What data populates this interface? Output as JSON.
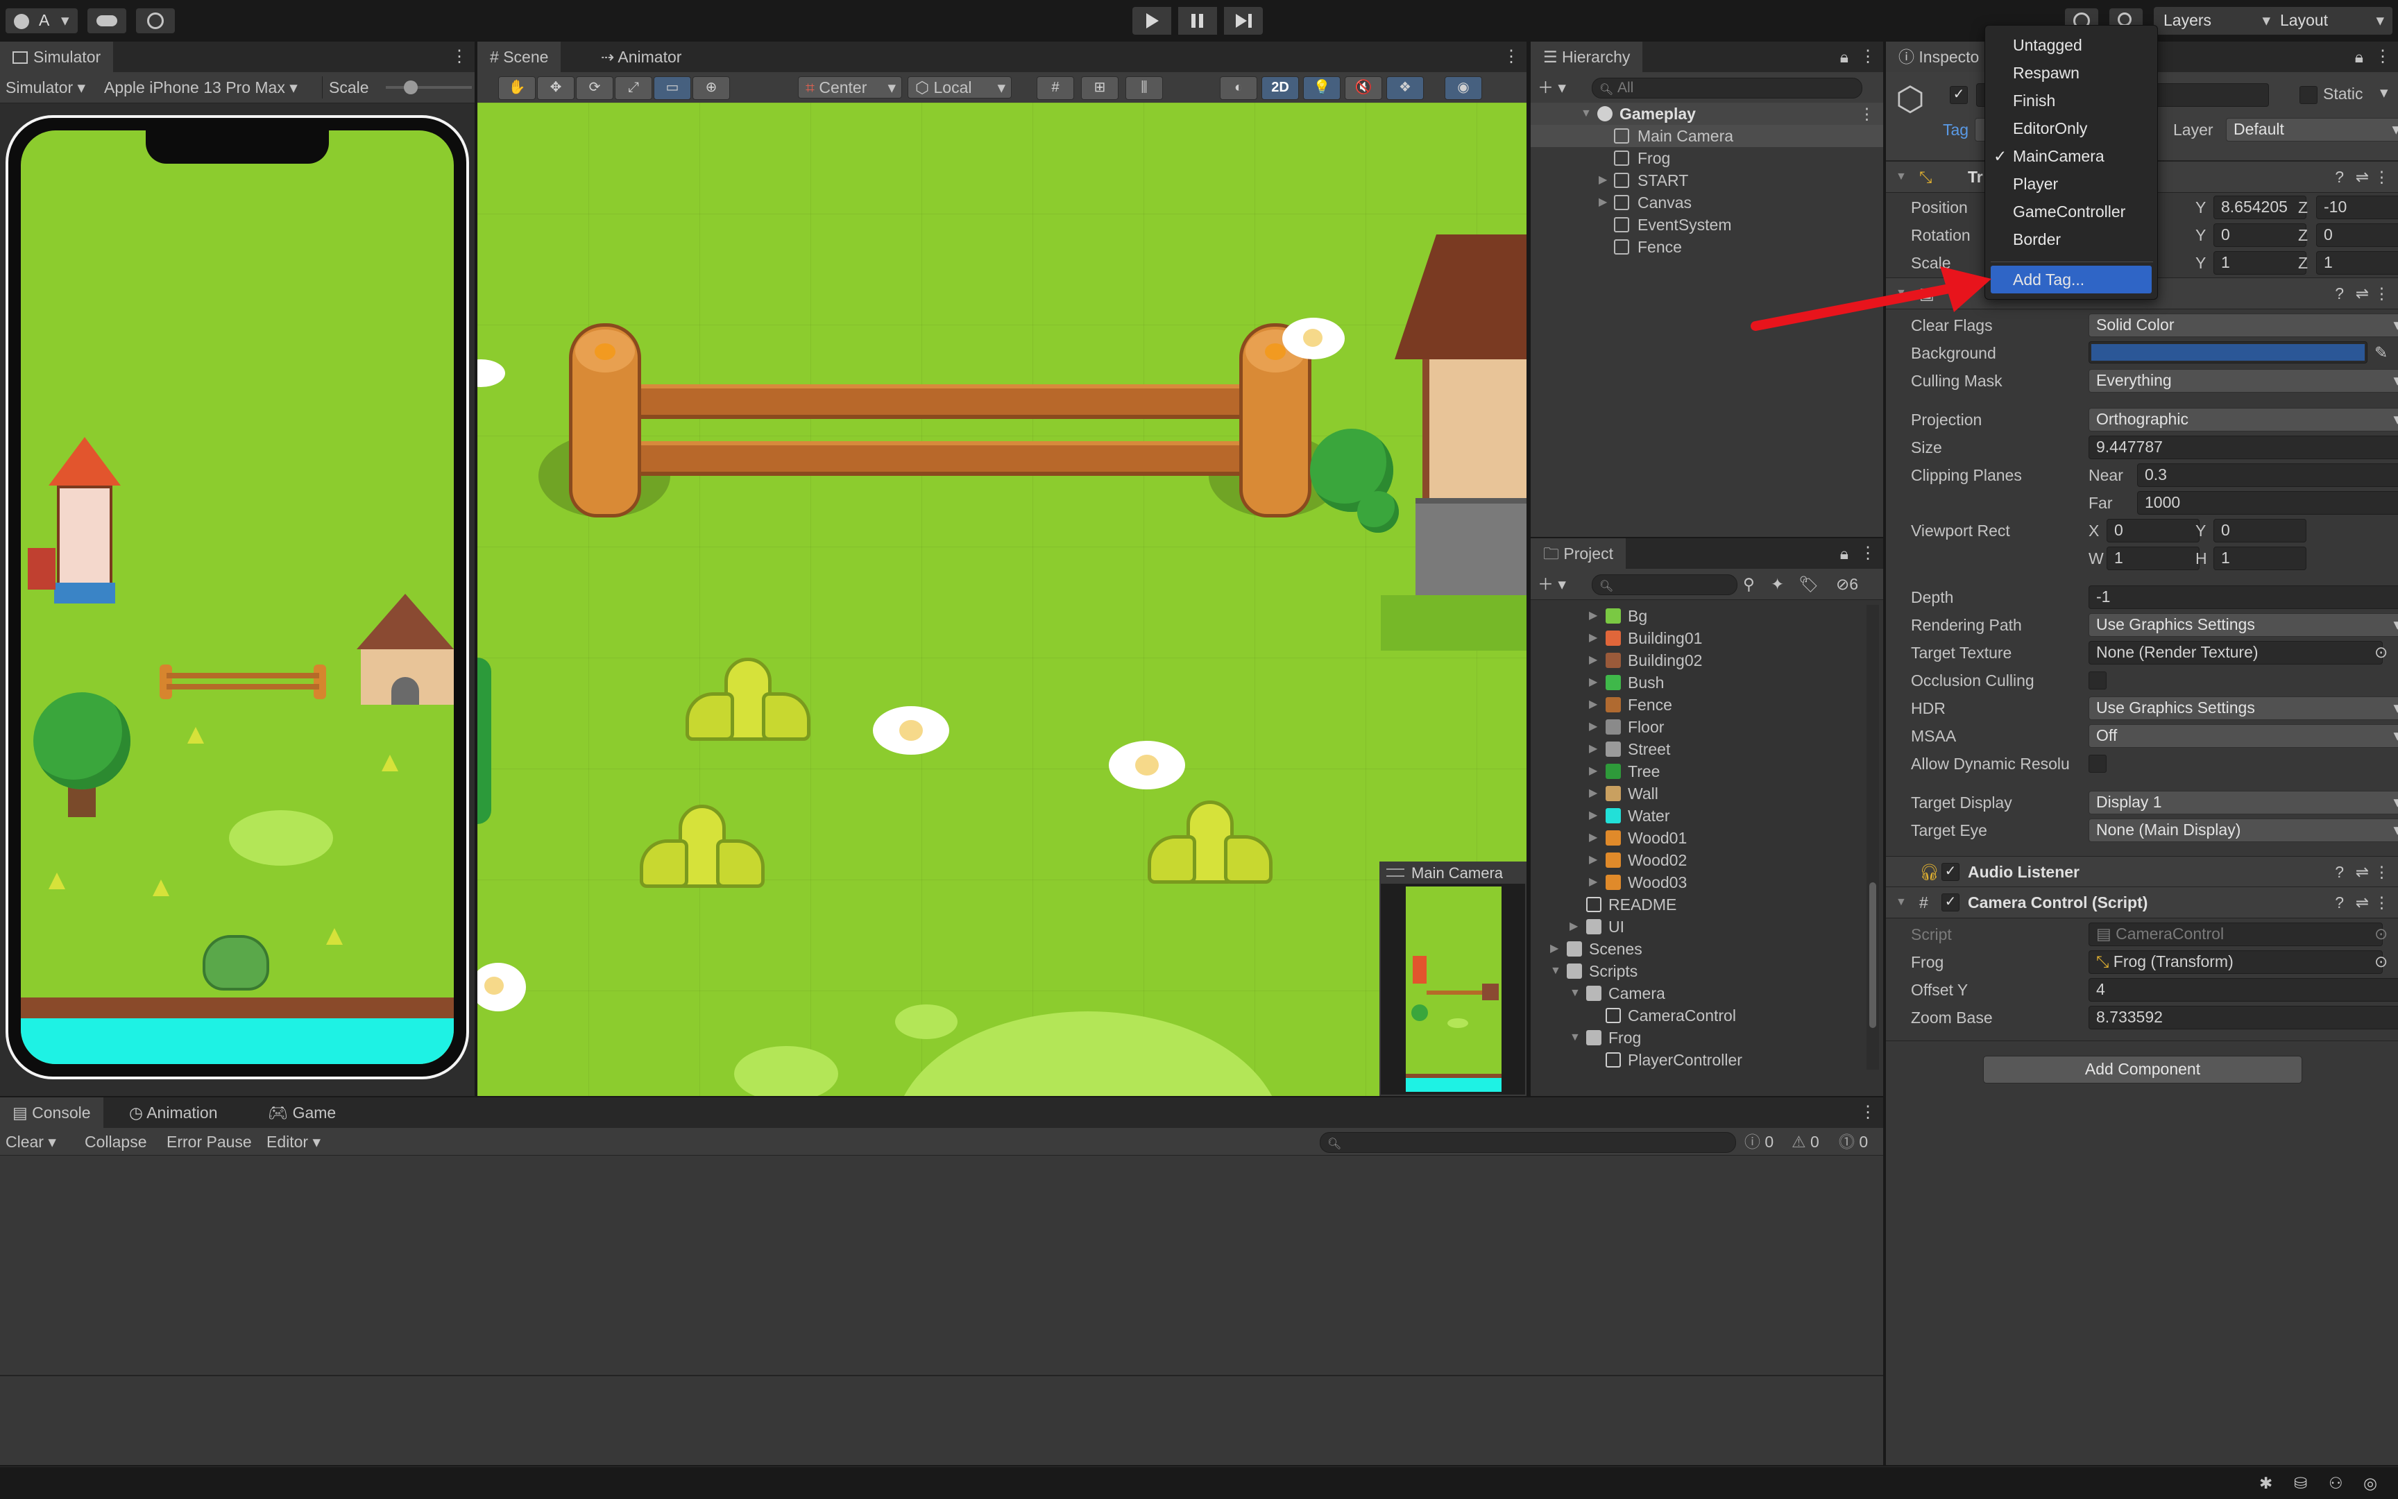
{
  "topbar": {
    "account_label": "A",
    "layers_label": "Layers",
    "layout_label": "Layout"
  },
  "simulator": {
    "tab_label": "Simulator",
    "mode_label": "Simulator",
    "device_label": "Apple iPhone 13 Pro Max",
    "scale_label": "Scale"
  },
  "scene": {
    "tab_scene": "Scene",
    "tab_animator": "Animator",
    "pivot_label": "Center",
    "space_label": "Local",
    "mode_2d_label": "2D",
    "camera_preview_label": "Main Camera"
  },
  "hierarchy": {
    "tab_label": "Hierarchy",
    "search_placeholder": "All",
    "root_label": "Gameplay",
    "items": [
      {
        "label": "Main Camera",
        "selected": true,
        "expandable": false
      },
      {
        "label": "Frog",
        "selected": false,
        "expandable": false
      },
      {
        "label": "START",
        "selected": false,
        "expandable": true
      },
      {
        "label": "Canvas",
        "selected": false,
        "expandable": true
      },
      {
        "label": "EventSystem",
        "selected": false,
        "expandable": false
      },
      {
        "label": "Fence",
        "selected": false,
        "expandable": false
      }
    ]
  },
  "project": {
    "tab_label": "Project",
    "hidden_count": "6",
    "items": [
      {
        "label": "Bg",
        "depth": 2,
        "icon": "sprite-icon",
        "color": "#7ac943"
      },
      {
        "label": "Building01",
        "depth": 2,
        "icon": "sprite-icon",
        "color": "#e0663a"
      },
      {
        "label": "Building02",
        "depth": 2,
        "icon": "sprite-icon",
        "color": "#9a5a3a"
      },
      {
        "label": "Bush",
        "depth": 2,
        "icon": "sprite-icon",
        "color": "#3fb84a"
      },
      {
        "label": "Fence",
        "depth": 2,
        "icon": "sprite-icon",
        "color": "#b06a30"
      },
      {
        "label": "Floor",
        "depth": 2,
        "icon": "sprite-icon",
        "color": "#8a8a8a"
      },
      {
        "label": "Street",
        "depth": 2,
        "icon": "sprite-icon",
        "color": "#9a9a9a"
      },
      {
        "label": "Tree",
        "depth": 2,
        "icon": "sprite-icon",
        "color": "#2e9a3a"
      },
      {
        "label": "Wall",
        "depth": 2,
        "icon": "sprite-icon",
        "color": "#c9a060"
      },
      {
        "label": "Water",
        "depth": 2,
        "icon": "sprite-icon",
        "color": "#22e0d8"
      },
      {
        "label": "Wood01",
        "depth": 2,
        "icon": "sprite-icon",
        "color": "#e08a2a"
      },
      {
        "label": "Wood02",
        "depth": 2,
        "icon": "sprite-icon",
        "color": "#e08a2a"
      },
      {
        "label": "Wood03",
        "depth": 2,
        "icon": "sprite-icon",
        "color": "#e08a2a"
      },
      {
        "label": "README",
        "depth": 1,
        "icon": "document-icon",
        "color": "#cfcfcf"
      },
      {
        "label": "UI",
        "depth": 1,
        "icon": "folder-icon",
        "color": "#b8b8b8"
      },
      {
        "label": "Scenes",
        "depth": 0,
        "icon": "folder-icon",
        "color": "#b8b8b8"
      },
      {
        "label": "Scripts",
        "depth": 0,
        "icon": "folder-open-icon",
        "color": "#b8b8b8"
      },
      {
        "label": "Camera",
        "depth": 1,
        "icon": "folder-open-icon",
        "color": "#b8b8b8"
      },
      {
        "label": "CameraControl",
        "depth": 2,
        "icon": "script-icon",
        "color": "#cfcfcf"
      },
      {
        "label": "Frog",
        "depth": 1,
        "icon": "folder-open-icon",
        "color": "#b8b8b8"
      },
      {
        "label": "PlayerController",
        "depth": 2,
        "icon": "script-icon",
        "color": "#cfcfcf"
      }
    ]
  },
  "console": {
    "tab_console": "Console",
    "tab_animation": "Animation",
    "tab_game": "Game",
    "clear_label": "Clear",
    "collapse_label": "Collapse",
    "error_pause_label": "Error Pause",
    "editor_label": "Editor",
    "info_count": "0",
    "warning_count": "0",
    "error_count": "0"
  },
  "inspector": {
    "tab_label": "Inspecto",
    "static_label": "Static",
    "tag_label": "Tag",
    "layer_label": "Layer",
    "layer_value": "Default",
    "transform": {
      "title": "Tr",
      "position_label": "Position",
      "rotation_label": "Rotation",
      "scale_label": "Scale",
      "position_y": "8.654205",
      "position_z": "-10",
      "rotation_y": "0",
      "rotation_z": "0",
      "scale_y": "1",
      "scale_z": "1",
      "y_axis": "Y",
      "z_axis": "Z"
    },
    "camera": {
      "clear_flags_label": "Clear Flags",
      "clear_flags_value": "Solid Color",
      "background_label": "Background",
      "background_color": "#2b5797",
      "culling_mask_label": "Culling Mask",
      "culling_mask_value": "Everything",
      "projection_label": "Projection",
      "projection_value": "Orthographic",
      "size_label": "Size",
      "size_value": "9.447787",
      "clipping_label": "Clipping Planes",
      "near_label": "Near",
      "near_value": "0.3",
      "far_label": "Far",
      "far_value": "1000",
      "viewport_label": "Viewport Rect",
      "vx_label": "X",
      "vx_value": "0",
      "vy_label": "Y",
      "vy_value": "0",
      "vw_label": "W",
      "vw_value": "1",
      "vh_label": "H",
      "vh_value": "1",
      "depth_label": "Depth",
      "depth_value": "-1",
      "rendering_path_label": "Rendering Path",
      "rendering_path_value": "Use Graphics Settings",
      "target_texture_label": "Target Texture",
      "target_texture_value": "None (Render Texture)",
      "occlusion_label": "Occlusion Culling",
      "hdr_label": "HDR",
      "hdr_value": "Use Graphics Settings",
      "msaa_label": "MSAA",
      "msaa_value": "Off",
      "dynamic_res_label": "Allow Dynamic Resolu",
      "target_display_label": "Target Display",
      "target_display_value": "Display 1",
      "target_eye_label": "Target Eye",
      "target_eye_value": "None (Main Display)"
    },
    "audio_listener_title": "Audio Listener",
    "camera_control": {
      "title": "Camera Control (Script)",
      "script_label": "Script",
      "script_value": "CameraControl",
      "frog_label": "Frog",
      "frog_value": "Frog (Transform)",
      "offset_label": "Offset Y",
      "offset_value": "4",
      "zoom_label": "Zoom Base",
      "zoom_value": "8.733592"
    },
    "add_component_label": "Add Component"
  },
  "tag_menu": {
    "items": [
      {
        "label": "Untagged",
        "checked": false
      },
      {
        "label": "Respawn",
        "checked": false
      },
      {
        "label": "Finish",
        "checked": false
      },
      {
        "label": "EditorOnly",
        "checked": false
      },
      {
        "label": "MainCamera",
        "checked": true
      },
      {
        "label": "Player",
        "checked": false
      },
      {
        "label": "GameController",
        "checked": false
      },
      {
        "label": "Border",
        "checked": false
      }
    ],
    "add_tag_label": "Add Tag...",
    "check_glyph": "✓"
  },
  "colors": {
    "accent": "#2f65c6",
    "grass": "#8ccc2e",
    "water": "#1ef2e4",
    "annotation_arrow": "#e8141c"
  }
}
